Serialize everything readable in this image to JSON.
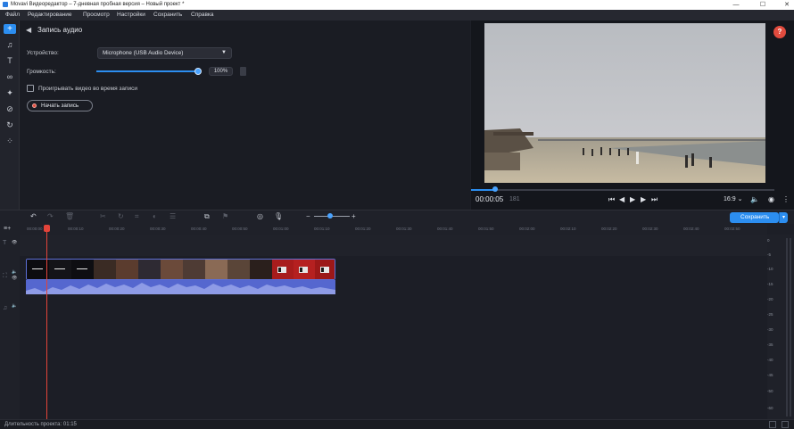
{
  "window": {
    "title": "Movavi Видеоредактор – 7-дневная пробная версия – Новый проект *",
    "minimize": "—",
    "maximize": "☐",
    "close": "✕"
  },
  "menu": [
    "Файл",
    "Редактирование",
    "Просмотр",
    "Настройки",
    "Сохранить",
    "Справка"
  ],
  "left_tools": {
    "add": "+",
    "items": [
      "music-icon",
      "text-icon",
      "transitions-icon",
      "effects-icon",
      "stickers-icon",
      "filters-icon",
      "more-tools-icon"
    ]
  },
  "record_panel": {
    "back": "◀",
    "title": "Запись аудио",
    "device_label": "Устройство:",
    "device_value": "Microphone (USB Audio Device)",
    "volume_label": "Громкость:",
    "volume_value": "100%",
    "volume_fraction": 1.0,
    "play_video_label": "Проигрывать видео во время записи",
    "play_video_checked": false,
    "record_button": "Начать запись"
  },
  "preview": {
    "help": "?",
    "timecode": "00:00:05",
    "timecode_frames": "181",
    "aspect": "16:9 ⌄",
    "progress_fraction": 0.08
  },
  "timeline_toolbar": {
    "save": "Сохранить",
    "save_dropdown": "▾",
    "zoom_fraction": 0.45
  },
  "ruler_ticks": [
    "00:00:00",
    "00:00:10",
    "00:00:20",
    "00:00:30",
    "00:00:40",
    "00:00:50",
    "00:01:00",
    "00:01:10",
    "00:01:20",
    "00:01:30",
    "00:01:40",
    "00:01:50",
    "00:02:00",
    "00:02:10",
    "00:02:20",
    "00:02:30",
    "00:02:40",
    "00:02:50"
  ],
  "meter_labels": [
    "0",
    "-5",
    "-10",
    "-15",
    "-20",
    "-25",
    "-30",
    "-35",
    "-40",
    "-45",
    "-50",
    "-60"
  ],
  "status": {
    "duration": "Длительность проекта: 01:15"
  },
  "colors": {
    "accent": "#2c8ef0",
    "record": "#e24a3c",
    "audio_clip": "#5567cf",
    "playhead": "#e3443a"
  }
}
